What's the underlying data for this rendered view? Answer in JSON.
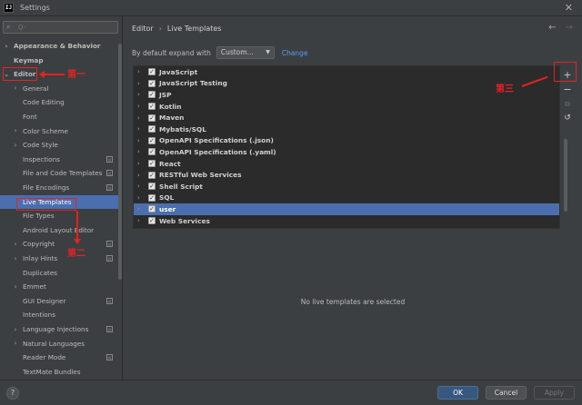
{
  "window": {
    "title": "Settings",
    "app_icon_text": "IJ"
  },
  "search": {
    "placeholder": "Q-"
  },
  "tree": [
    {
      "label": "Appearance & Behavior",
      "chev": "right",
      "bold": true,
      "indent": 0
    },
    {
      "label": "Keymap",
      "chev": "",
      "bold": true,
      "indent": 0
    },
    {
      "label": "Editor",
      "chev": "down",
      "bold": true,
      "indent": 0
    },
    {
      "label": "General",
      "chev": "right",
      "indent": 1
    },
    {
      "label": "Code Editing",
      "chev": "",
      "indent": 1
    },
    {
      "label": "Font",
      "chev": "",
      "indent": 1
    },
    {
      "label": "Color Scheme",
      "chev": "right",
      "indent": 1
    },
    {
      "label": "Code Style",
      "chev": "right",
      "indent": 1
    },
    {
      "label": "Inspections",
      "chev": "",
      "indent": 1,
      "proj": true
    },
    {
      "label": "File and Code Templates",
      "chev": "",
      "indent": 1,
      "proj": true
    },
    {
      "label": "File Encodings",
      "chev": "",
      "indent": 1,
      "proj": true
    },
    {
      "label": "Live Templates",
      "chev": "",
      "indent": 1,
      "selected": true
    },
    {
      "label": "File Types",
      "chev": "",
      "indent": 1
    },
    {
      "label": "Android Layout Editor",
      "chev": "",
      "indent": 1
    },
    {
      "label": "Copyright",
      "chev": "right",
      "indent": 1,
      "proj": true
    },
    {
      "label": "Inlay Hints",
      "chev": "right",
      "indent": 1,
      "proj": true
    },
    {
      "label": "Duplicates",
      "chev": "",
      "indent": 1
    },
    {
      "label": "Emmet",
      "chev": "right",
      "indent": 1
    },
    {
      "label": "GUI Designer",
      "chev": "",
      "indent": 1,
      "proj": true
    },
    {
      "label": "Intentions",
      "chev": "",
      "indent": 1
    },
    {
      "label": "Language Injections",
      "chev": "right",
      "indent": 1,
      "proj": true
    },
    {
      "label": "Natural Languages",
      "chev": "right",
      "indent": 1
    },
    {
      "label": "Reader Mode",
      "chev": "",
      "indent": 1,
      "proj": true
    },
    {
      "label": "TextMate Bundles",
      "chev": "",
      "indent": 1
    }
  ],
  "breadcrumb": {
    "parent": "Editor",
    "sep": "›",
    "current": "Live Templates"
  },
  "expand": {
    "label": "By default expand with",
    "value": "Custom...",
    "change_link": "Change"
  },
  "templates": [
    {
      "label": "JavaScript"
    },
    {
      "label": "JavaScript Testing"
    },
    {
      "label": "JSP"
    },
    {
      "label": "Kotlin"
    },
    {
      "label": "Maven"
    },
    {
      "label": "Mybatis/SQL"
    },
    {
      "label": "OpenAPI Specifications (.json)"
    },
    {
      "label": "OpenAPI Specifications (.yaml)"
    },
    {
      "label": "React"
    },
    {
      "label": "RESTful Web Services"
    },
    {
      "label": "Shell Script"
    },
    {
      "label": "SQL"
    },
    {
      "label": "user",
      "selected": true
    },
    {
      "label": "Web Services"
    }
  ],
  "tools": {
    "add": "+",
    "remove": "−",
    "copy": "⧉",
    "restore": "↺"
  },
  "empty_message": "No live templates are selected",
  "annotations": {
    "first": "第一",
    "second": "第二",
    "third": "第三"
  },
  "buttons": {
    "help": "?",
    "ok": "OK",
    "cancel": "Cancel",
    "apply": "Apply"
  },
  "colors": {
    "accent": "#4b6eaf",
    "annotation": "#e52222",
    "link": "#589df6"
  }
}
